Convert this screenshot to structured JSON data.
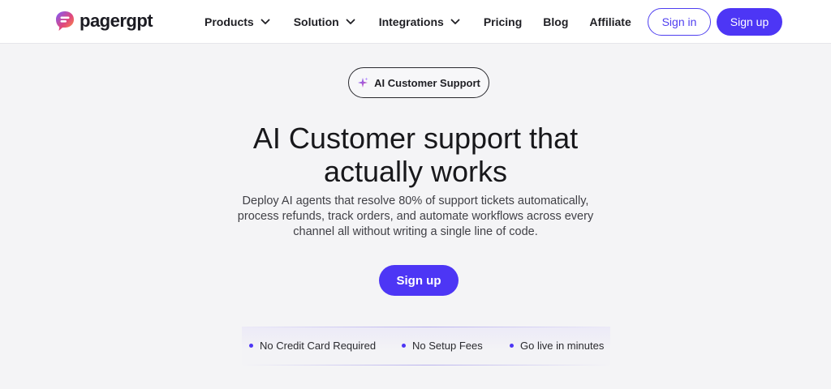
{
  "brand": {
    "name": "pagergpt"
  },
  "nav": {
    "items": [
      {
        "label": "Products",
        "has_dropdown": true
      },
      {
        "label": "Solution",
        "has_dropdown": true
      },
      {
        "label": "Integrations",
        "has_dropdown": true
      },
      {
        "label": "Pricing",
        "has_dropdown": false
      },
      {
        "label": "Blog",
        "has_dropdown": false
      },
      {
        "label": "Affiliate",
        "has_dropdown": false
      }
    ]
  },
  "header": {
    "sign_in_label": "Sign in",
    "sign_up_label": "Sign up"
  },
  "hero": {
    "badge_label": "AI Customer Support",
    "title_line1": "AI Customer support that",
    "title_line2": "actually works",
    "subtitle": "Deploy AI agents that resolve 80% of support tickets automatically, process refunds, track orders, and automate workflows across every channel all without writing a single line of code.",
    "cta_label": "Sign up"
  },
  "features": [
    "No Credit Card Required",
    "No Setup Fees",
    "Go live in minutes"
  ],
  "colors": {
    "accent": "#4d36f5",
    "background": "#f4f4f6",
    "header_bg": "#ffffff",
    "text": "#18181b"
  },
  "icons": {
    "logo": "chat-bubble-logo-icon",
    "dropdown": "chevron-down-icon",
    "badge": "sparkle-icon",
    "feature_bullet": "dot-icon"
  }
}
